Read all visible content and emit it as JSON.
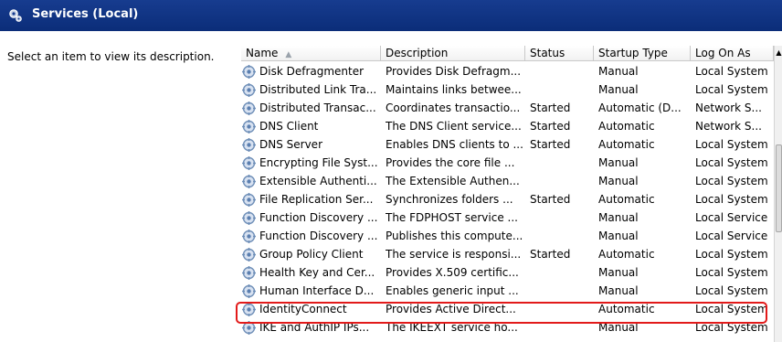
{
  "header": {
    "title": "Services (Local)",
    "icon": "services-gear-icon"
  },
  "left_pane": {
    "description": "Select an item to view its description."
  },
  "columns": [
    "Name",
    "Description",
    "Status",
    "Startup Type",
    "Log On As"
  ],
  "rows": [
    [
      "Disk Defragmenter",
      "Provides Disk Defragm...",
      "",
      "Manual",
      "Local System"
    ],
    [
      "Distributed Link Tra...",
      "Maintains links betwee...",
      "",
      "Manual",
      "Local System"
    ],
    [
      "Distributed Transac...",
      "Coordinates transactio...",
      "Started",
      "Automatic (D...",
      "Network S..."
    ],
    [
      "DNS Client",
      "The DNS Client service...",
      "Started",
      "Automatic",
      "Network S..."
    ],
    [
      "DNS Server",
      "Enables DNS clients to ...",
      "Started",
      "Automatic",
      "Local System"
    ],
    [
      "Encrypting File Syst...",
      "Provides the core file ...",
      "",
      "Manual",
      "Local System"
    ],
    [
      "Extensible Authenti...",
      "The Extensible Authen...",
      "",
      "Manual",
      "Local System"
    ],
    [
      "File Replication Ser...",
      "Synchronizes folders ...",
      "Started",
      "Automatic",
      "Local System"
    ],
    [
      "Function Discovery ...",
      "The FDPHOST service ...",
      "",
      "Manual",
      "Local Service"
    ],
    [
      "Function Discovery ...",
      "Publishes this compute...",
      "",
      "Manual",
      "Local Service"
    ],
    [
      "Group Policy Client",
      "The service is responsi...",
      "Started",
      "Automatic",
      "Local System"
    ],
    [
      "Health Key and Cer...",
      "Provides X.509 certific...",
      "",
      "Manual",
      "Local System"
    ],
    [
      "Human Interface D...",
      "Enables generic input ...",
      "",
      "Manual",
      "Local System"
    ],
    [
      "IdentityConnect",
      "Provides Active Direct...",
      "",
      "Automatic",
      "Local System"
    ],
    [
      "IKE and AuthIP IPs...",
      "The IKEEXT service ho...",
      "",
      "Manual",
      "Local System"
    ]
  ],
  "highlighted_row": "IdentityConnect",
  "colors": {
    "header_bg": "#0b2d79",
    "highlight": "#e21a1a"
  }
}
